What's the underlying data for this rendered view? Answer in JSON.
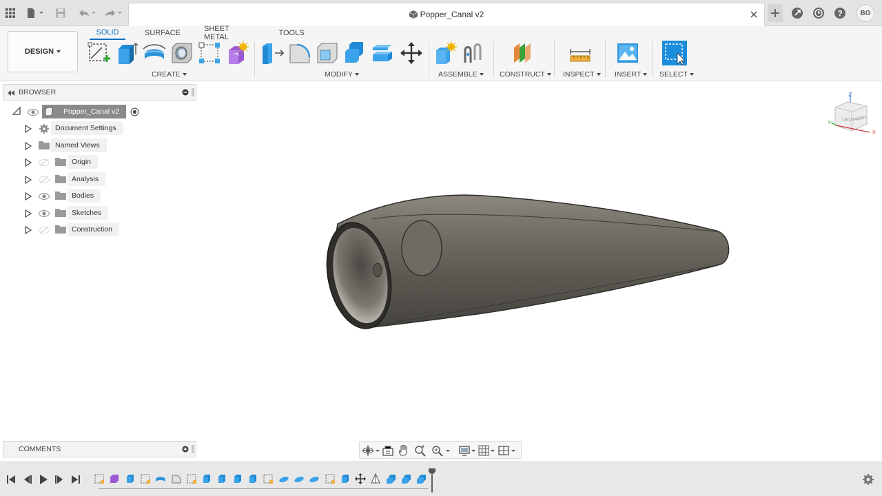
{
  "document": {
    "title": "Popper_Canal v2",
    "user_initials": "BG"
  },
  "topbar": {
    "icons": [
      "grid-menu-icon",
      "file-icon",
      "save-icon",
      "undo-icon",
      "redo-icon",
      "close-icon",
      "new-tab-icon",
      "job-status-icon",
      "history-icon",
      "help-icon"
    ]
  },
  "workspace": {
    "label": "DESIGN"
  },
  "ribbon": {
    "tabs": [
      {
        "label": "SOLID",
        "active": true
      },
      {
        "label": "SURFACE",
        "active": false
      },
      {
        "label": "SHEET METAL",
        "active": false
      },
      {
        "label": "TOOLS",
        "active": false
      }
    ],
    "groups": [
      {
        "label": "CREATE"
      },
      {
        "label": "MODIFY"
      },
      {
        "label": "ASSEMBLE"
      },
      {
        "label": "CONSTRUCT"
      },
      {
        "label": "INSPECT"
      },
      {
        "label": "INSERT"
      },
      {
        "label": "SELECT"
      }
    ]
  },
  "browser": {
    "title": "BROWSER",
    "root": "Popper_Canal v2",
    "items": [
      {
        "label": "Document Settings",
        "icon": "gear-icon",
        "visible": null
      },
      {
        "label": "Named Views",
        "icon": "folder-icon",
        "visible": null
      },
      {
        "label": "Origin",
        "icon": "folder-icon",
        "visible": false
      },
      {
        "label": "Analysis",
        "icon": "folder-icon",
        "visible": false
      },
      {
        "label": "Bodies",
        "icon": "folder-icon",
        "visible": true
      },
      {
        "label": "Sketches",
        "icon": "folder-icon",
        "visible": true
      },
      {
        "label": "Construction",
        "icon": "folder-icon",
        "visible": false
      }
    ]
  },
  "viewcube": {
    "left": "LEFT",
    "front": "FRONT",
    "axis_z": "Z",
    "axis_x": "X",
    "axis_y": "Y"
  },
  "comments": {
    "title": "COMMENTS"
  },
  "colors": {
    "accent": "#0b6bbd",
    "select_blue": "#1a8ddc",
    "body_gray": "#6b6862"
  }
}
